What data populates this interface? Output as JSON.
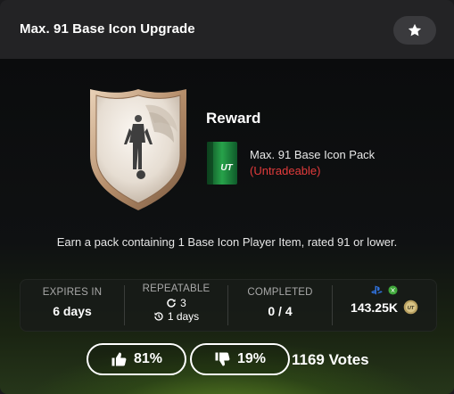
{
  "header": {
    "title": "Max. 91 Base Icon Upgrade",
    "favorite_icon": "star-icon"
  },
  "reward": {
    "heading": "Reward",
    "pack_name": "Max. 91 Base Icon Pack",
    "pack_tradeable": "(Untradeable)",
    "pack_label": "UT"
  },
  "description": "Earn a pack containing 1 Base Icon Player Item, rated 91 or lower.",
  "stats": {
    "expires": {
      "label": "EXPIRES IN",
      "value": "6 days"
    },
    "repeatable": {
      "label": "REPEATABLE",
      "count": "3",
      "interval": "1 days"
    },
    "completed": {
      "label": "COMPLETED",
      "value": "0 / 4"
    },
    "cost": {
      "value": "143.25K",
      "platforms": [
        "playstation-icon",
        "xbox-icon"
      ],
      "currency_icon": "ut-coin-icon",
      "coin_label": "UT"
    }
  },
  "votes": {
    "upvote_pct": "81%",
    "downvote_pct": "19%",
    "total": "1169 Votes"
  },
  "colors": {
    "untradeable": "#e23b3b",
    "accent_green": "#3a7d1f",
    "pack_green": "#1f7a3a",
    "playstation": "#2f6fd6",
    "xbox": "#3fa83a"
  }
}
